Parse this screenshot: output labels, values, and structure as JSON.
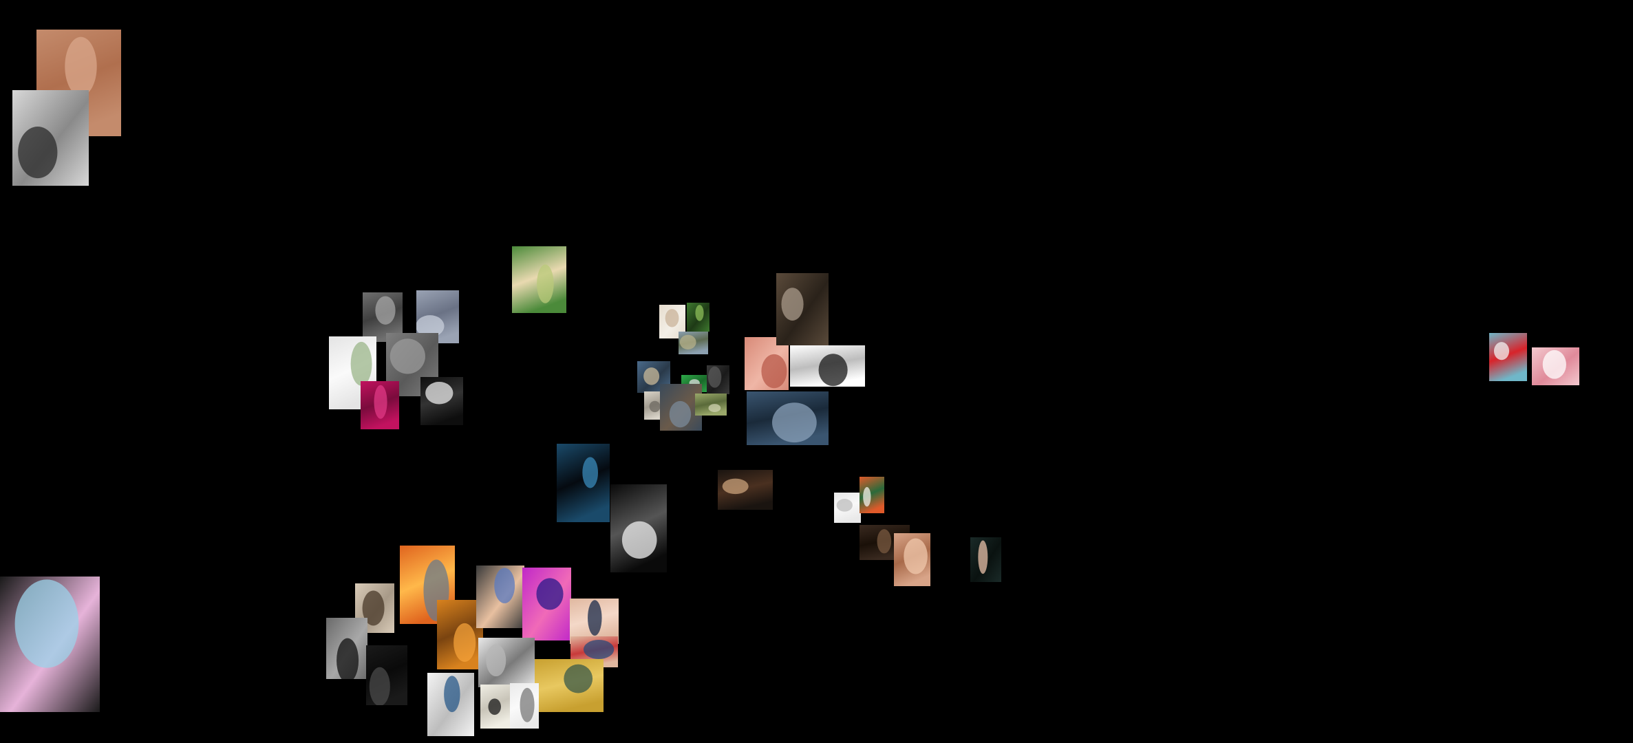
{
  "canvas": {
    "background": "#000000",
    "photos": [
      {
        "subject": "desert-figure-photo",
        "colors": [
          "#c48b6c",
          "#d9a78b",
          "#b06f4e"
        ]
      },
      {
        "subject": "bw-portrait-shush-photo",
        "colors": [
          "#d8d8d8",
          "#2b2b2b",
          "#8a8a8a"
        ]
      },
      {
        "subject": "man-with-flower-photo",
        "colors": [
          "#4b8a3a",
          "#b9c97a",
          "#e9d9b0"
        ]
      },
      {
        "subject": "urban-wall-photo",
        "colors": [
          "#6f6f6f",
          "#a6a6a6",
          "#3f3f3f"
        ]
      },
      {
        "subject": "hazy-sky-photo",
        "colors": [
          "#9aa3b4",
          "#c8cfdb",
          "#6a7285"
        ]
      },
      {
        "subject": "flower-bouquet-photo",
        "colors": [
          "#e4e4e4",
          "#9bb58a",
          "#fafafa"
        ]
      },
      {
        "subject": "gray-fog-photo",
        "colors": [
          "#7e7e7e",
          "#9b9b9b",
          "#5a5a5a"
        ]
      },
      {
        "subject": "magenta-petals-photo",
        "colors": [
          "#c2125f",
          "#e03a85",
          "#7a0b3c"
        ]
      },
      {
        "subject": "foot-sculpture-photo",
        "colors": [
          "#0e0e0e",
          "#e9e9e9",
          "#333333"
        ]
      },
      {
        "subject": "small-figurine-photo",
        "colors": [
          "#e6dccd",
          "#c9b39a",
          "#f3efe7"
        ]
      },
      {
        "subject": "green-leaves-photo",
        "colors": [
          "#3e7a2f",
          "#8dbf5a",
          "#1e3a16"
        ]
      },
      {
        "subject": "landscape-small-photo",
        "colors": [
          "#8ca0b0",
          "#b7b28b",
          "#5d6b52"
        ]
      },
      {
        "subject": "street-crowd-photo",
        "colors": [
          "#4a6a8a",
          "#c9b99a",
          "#2a3a4a"
        ]
      },
      {
        "subject": "green-screen-photo",
        "colors": [
          "#2eaa4a",
          "#e0e0e0",
          "#1a6a2a"
        ]
      },
      {
        "subject": "dark-curtain-photo",
        "colors": [
          "#3a3a3a",
          "#5a5a5a",
          "#1a1a1a"
        ]
      },
      {
        "subject": "pink-flowers-photo",
        "colors": [
          "#d88a78",
          "#b85a4a",
          "#efb6a6"
        ]
      },
      {
        "subject": "mirror-interior-photo",
        "colors": [
          "#5a4a3a",
          "#a89a8a",
          "#2a221a"
        ]
      },
      {
        "subject": "white-hand-photo",
        "colors": [
          "#ffffff",
          "#1a1a1a",
          "#bdbdbd"
        ]
      },
      {
        "subject": "old-photo-frame-photo",
        "colors": [
          "#d9d4c9",
          "#6e6a62",
          "#a29c90"
        ]
      },
      {
        "subject": "interior-room-photo",
        "colors": [
          "#3a4a5a",
          "#7a8a9a",
          "#6a5a4a"
        ]
      },
      {
        "subject": "field-landscape-photo",
        "colors": [
          "#9aa86a",
          "#cfd1b0",
          "#5a6a3a"
        ]
      },
      {
        "subject": "harbor-dusk-photo",
        "colors": [
          "#3a5570",
          "#8aa0b8",
          "#1a2a3a"
        ]
      },
      {
        "subject": "sea-silhouette-photo",
        "colors": [
          "#1a4a6a",
          "#3a8aba",
          "#050a10"
        ]
      },
      {
        "subject": "ink-vortex-photo",
        "colors": [
          "#0a0a0a",
          "#eeeeee",
          "#555555"
        ]
      },
      {
        "subject": "dancers-dark-photo",
        "colors": [
          "#1a1410",
          "#c8a07a",
          "#4a3020"
        ]
      },
      {
        "subject": "white-hair-portrait-photo",
        "colors": [
          "#e9e9e9",
          "#bdbdbd",
          "#f8f8f8"
        ]
      },
      {
        "subject": "orange-door-photo",
        "colors": [
          "#e05a2a",
          "#f3f0ea",
          "#2a6a3a"
        ]
      },
      {
        "subject": "dark-library-photo",
        "colors": [
          "#3a2a20",
          "#7a5a40",
          "#1a1008"
        ]
      },
      {
        "subject": "skin-closeup-photo",
        "colors": [
          "#d8a488",
          "#f0c8ac",
          "#a86a4a"
        ]
      },
      {
        "subject": "hand-on-face-photo",
        "colors": [
          "#1a2a28",
          "#e8c0a8",
          "#0a1210"
        ]
      },
      {
        "subject": "pioneer-girl-photo",
        "colors": [
          "#6fb7c9",
          "#f2f2f2",
          "#d8232a"
        ]
      },
      {
        "subject": "pink-outfit-photo",
        "colors": [
          "#f3c9cf",
          "#ffffff",
          "#e08a9a"
        ]
      },
      {
        "subject": "iridescent-abstract-photo",
        "colors": [
          "#1a1a1a",
          "#9bd1e8",
          "#e6b3d9"
        ]
      },
      {
        "subject": "wildfire-photo",
        "colors": [
          "#e0641e",
          "#6a7a8a",
          "#ffb84a"
        ]
      },
      {
        "subject": "helmet-portrait-photo",
        "colors": [
          "#d9cbb8",
          "#4a3a2a",
          "#a89a88"
        ]
      },
      {
        "subject": "bare-legs-photo",
        "colors": [
          "#6a6a6a",
          "#111111",
          "#a8a8a8"
        ]
      },
      {
        "subject": "crowned-statue-photo",
        "colors": [
          "#1a1a1a",
          "#4a4a4a",
          "#0a0a0a"
        ]
      },
      {
        "subject": "orange-lockers-photo",
        "colors": [
          "#d8821e",
          "#f4a23a",
          "#7a4410"
        ]
      },
      {
        "subject": "lying-figure-photo",
        "colors": [
          "#3a3a3a",
          "#5a7ac0",
          "#e8c0a0"
        ]
      },
      {
        "subject": "neon-forest-photo",
        "colors": [
          "#c028c8",
          "#2a1a8a",
          "#f06ab8"
        ]
      },
      {
        "subject": "hands-suit-photo",
        "colors": [
          "#e0b8a0",
          "#1a2a4a",
          "#f4d8c8"
        ]
      },
      {
        "subject": "white-kitchen-photo",
        "colors": [
          "#e8e8e8",
          "#b8b8b8",
          "#7a7a7a"
        ]
      },
      {
        "subject": "hands-blue-photo",
        "colors": [
          "#e0b8a0",
          "#2a4a7a",
          "#c83a3a"
        ]
      },
      {
        "subject": "aerial-delta-photo",
        "colors": [
          "#c8a030",
          "#3a5a4a",
          "#e8c860"
        ]
      },
      {
        "subject": "magazine-page-photo",
        "colors": [
          "#f4f4f4",
          "#2a5a8a",
          "#bdbdbd"
        ]
      },
      {
        "subject": "still-life-photo",
        "colors": [
          "#f0eee4",
          "#1a1a1a",
          "#c8c4b8"
        ]
      },
      {
        "subject": "bird-sculpture-photo",
        "colors": [
          "#eaeaea",
          "#7a7a7a",
          "#fafafa"
        ]
      }
    ]
  }
}
